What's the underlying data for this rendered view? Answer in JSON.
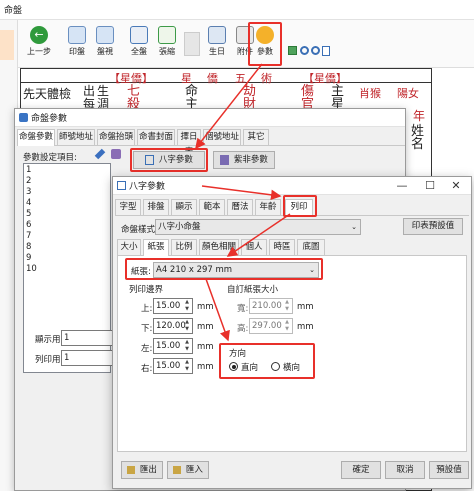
{
  "main_window": {
    "title": "命盤",
    "toolbar": {
      "buttons": [
        {
          "label": "上一步",
          "icon": "back-arrow-icon"
        },
        {
          "label": "印盤",
          "icon": "print-chart-icon"
        },
        {
          "label": "盤視",
          "icon": "chart-view-icon"
        },
        {
          "label": "全盤",
          "icon": "full-chart-icon"
        },
        {
          "label": "張縮",
          "icon": "expand-icon"
        },
        {
          "label": "生日",
          "icon": "birthday-icon"
        },
        {
          "label": "附件",
          "icon": "attachment-icon"
        },
        {
          "label": "參數",
          "icon": "settings-icon"
        }
      ]
    },
    "chart": {
      "header_cells": [
        "【星僑】",
        "星",
        "僑",
        "五",
        "術",
        "【星僑】"
      ],
      "left_text": [
        "先天體檢",
        "出每",
        "生淍"
      ],
      "cells": [
        "七殺",
        "命主",
        "劫財",
        "傷官",
        "主星",
        "肖猴",
        "陽女"
      ],
      "right_text": [
        "年",
        "姓名"
      ]
    }
  },
  "params_window": {
    "title": "命盤參數",
    "tabs": [
      "命盤參數",
      "師號地址",
      "命盤抬頭",
      "命書封面",
      "擇日表",
      "個號地址",
      "其它"
    ],
    "list_label": "參數設定項目:",
    "list_items": [
      "1",
      "2",
      "3",
      "4",
      "5",
      "6",
      "7",
      "8",
      "9",
      "10"
    ],
    "bazi_button": "八字參數",
    "ziwei_button": "紫非參數",
    "display_label": "顯示用:",
    "display_value": "1",
    "print_label": "列印用:",
    "print_value": "1"
  },
  "bazi_window": {
    "title": "八字參數",
    "tabs": [
      "字型",
      "排盤",
      "顯示",
      "範本",
      "曆法",
      "年齡",
      "列印"
    ],
    "style_label": "命盤樣式:",
    "style_value": "八字小命盤",
    "preset_button": "印表預設值",
    "subtabs": [
      "大小",
      "紙張",
      "比例",
      "顏色相關",
      "個人",
      "時區",
      "底圖"
    ],
    "paper_label": "紙張:",
    "paper_value": "A4 210 x 297 mm",
    "margins_group": "列印邊界",
    "margin_top_label": "上:",
    "margin_top": "15.00",
    "margin_bottom_label": "下:",
    "margin_bottom": "120.00",
    "margin_left_label": "左:",
    "margin_left": "15.00",
    "margin_right_label": "右:",
    "margin_right": "15.00",
    "unit": "mm",
    "custom_group": "自訂紙張大小",
    "width_label": "寬:",
    "width_value": "210.00",
    "height_label": "高:",
    "height_value": "297.00",
    "direction_group": "方向",
    "portrait_label": "直向",
    "landscape_label": "橫向",
    "export_button": "匯出",
    "import_button": "匯入",
    "ok_button": "確定",
    "cancel_button": "取消",
    "default_button": "預設值"
  },
  "colors": {
    "highlight": "#e8302a",
    "chart_red": "#c0262b",
    "selection": "#cce4f7"
  }
}
